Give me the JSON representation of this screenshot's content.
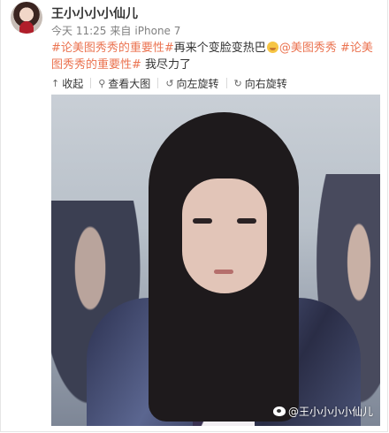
{
  "post": {
    "username": "王小小小小仙儿",
    "time": "今天 11:25",
    "source_prefix": "来自",
    "source": "iPhone 7",
    "text": {
      "topic1": "#论美图秀秀的重要性#",
      "text1": "再来个变脸变热巴",
      "emoji": "doge-emoji",
      "mention": "@美图秀秀",
      "topic2": "#论美图秀秀的重要性#",
      "text2": " 我尽力了"
    }
  },
  "toolbar": {
    "collapse": "收起",
    "view_large": "查看大图",
    "rotate_left": "向左旋转",
    "rotate_right": "向右旋转"
  },
  "icons": {
    "collapse": "up-arrow-icon",
    "view_large": "magnifier-icon",
    "rotate_left": "rotate-left-icon",
    "rotate_right": "rotate-right-icon"
  },
  "watermark": "@王小小小小仙儿",
  "colors": {
    "topic": "#eb7350",
    "text": "#333333",
    "meta": "#808080"
  }
}
